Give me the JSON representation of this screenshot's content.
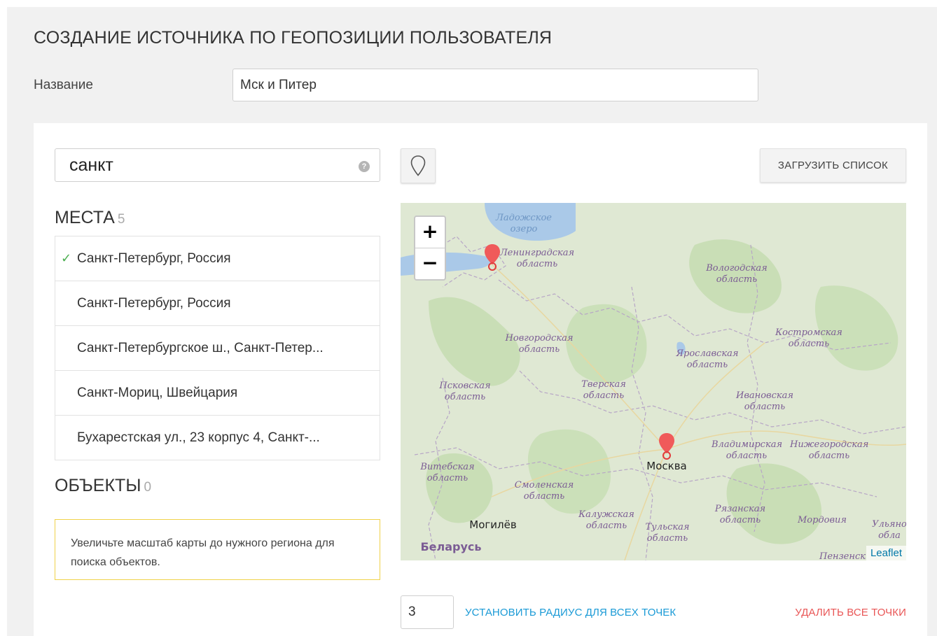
{
  "page": {
    "title": "СОЗДАНИЕ ИСТОЧНИКА ПО ГЕОПОЗИЦИИ ПОЛЬЗОВАТЕЛЯ",
    "name_label": "Название",
    "name_value": "Мск и Питер"
  },
  "search": {
    "value": "санкт",
    "help_icon": "question-circle-icon"
  },
  "toolbar": {
    "pin_icon": "map-pin-outline-icon",
    "load_label": "ЗАГРУЗИТЬ СПИСОК"
  },
  "places": {
    "heading": "МЕСТА",
    "count": "5",
    "items": [
      {
        "label": "Санкт-Петербург, Россия",
        "checked": true
      },
      {
        "label": "Санкт-Петербург, Россия",
        "checked": false
      },
      {
        "label": "Санкт-Петербургское ш., Санкт-Петер...",
        "checked": false
      },
      {
        "label": "Санкт-Мориц, Швейцария",
        "checked": false
      },
      {
        "label": "Бухарестская ул., 23 корпус 4, Санкт-...",
        "checked": false
      }
    ]
  },
  "objects": {
    "heading": "ОБЪЕКТЫ",
    "count": "0",
    "notice": "Увеличьте масштаб карты до нужного региона для поиска объектов."
  },
  "map": {
    "zoom_in": "+",
    "zoom_out": "−",
    "attribution": "Leaflet",
    "labels": {
      "ladoga": "Ладожское озеро",
      "leningrad": "Ленинградская область",
      "vologda": "Вологодская область",
      "novgorod": "Новгородская область",
      "kostroma": "Костромская область",
      "yaroslavl": "Ярославская область",
      "pskov": "Псковская область",
      "tver": "Тверская область",
      "ivanovo": "Ивановская область",
      "vladimir": "Владимирская область",
      "nizhny": "Нижегородская область",
      "moscow": "Москва",
      "vitebsk": "Витебская область",
      "smolensk": "Смоленская область",
      "ryazan": "Рязанская область",
      "mogilev": "Могилёв",
      "kaluga": "Калужская область",
      "tula": "Тульская область",
      "mordovia": "Мордовия",
      "ulyan": "Ульяно обла",
      "belarus": "Беларусь",
      "penza": "Пензенск"
    },
    "markers": [
      {
        "name": "Санкт-Петербург"
      },
      {
        "name": "Москва"
      }
    ],
    "colors": {
      "marker": "#f05a5a",
      "land": "#dfe8d3",
      "forest": "#c7dcb4",
      "water": "#aac9e8"
    }
  },
  "footer": {
    "radius_value": "3",
    "set_radius_label": "УСТАНОВИТЬ РАДИУС ДЛЯ ВСЕХ ТОЧЕК",
    "delete_all_label": "УДАЛИТЬ ВСЕ ТОЧКИ"
  }
}
